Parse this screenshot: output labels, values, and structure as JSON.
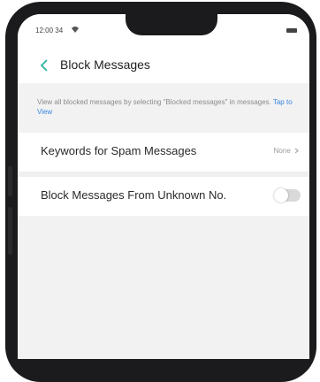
{
  "status_bar": {
    "time": "12:00 34"
  },
  "header": {
    "title": "Block Messages"
  },
  "info": {
    "text": "View all blocked messages by selecting \"Blocked messages\" in messages.",
    "link": "Tap to View"
  },
  "settings": {
    "keywords_label": "Keywords for Spam Messages",
    "keywords_value": "None",
    "block_unknown_label": "Block  Messages From Unknown No.",
    "block_unknown_enabled": false
  },
  "colors": {
    "accent": "#3a86e0",
    "screen_bg": "#f2f2f2",
    "phone_frame": "#1b1b1d"
  },
  "icons": [
    "back-arrow-icon",
    "wifi-icon",
    "battery-icon",
    "chevron-right-icon"
  ]
}
